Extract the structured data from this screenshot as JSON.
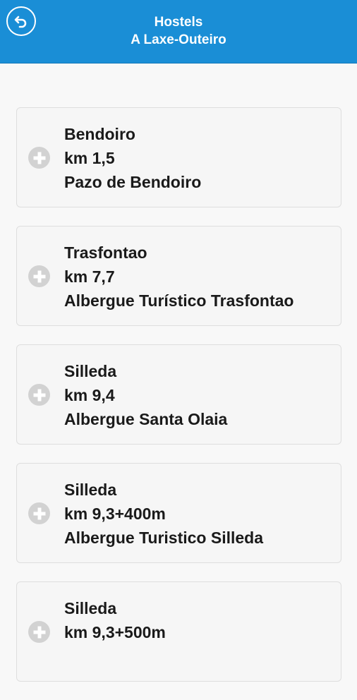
{
  "header": {
    "title_line1": "Hostels",
    "title_line2": "A Laxe-Outeiro",
    "back_icon": "back-arrow-icon"
  },
  "hostels": [
    {
      "place": "Bendoiro",
      "km": "km 1,5",
      "name": "Pazo de Bendoiro"
    },
    {
      "place": "Trasfontao",
      "km": "km 7,7",
      "name": "Albergue Turístico Trasfontao"
    },
    {
      "place": "Silleda",
      "km": "km 9,4",
      "name": "Albergue Santa Olaia"
    },
    {
      "place": "Silleda",
      "km": "km 9,3+400m",
      "name": "Albergue Turistico Silleda"
    },
    {
      "place": "Silleda",
      "km": "km 9,3+500m",
      "name": ""
    }
  ],
  "colors": {
    "header_bg": "#1a8ed6",
    "page_bg": "#f8f8f8",
    "card_bg": "#f6f6f6",
    "plus_icon": "#d2d2d2"
  }
}
